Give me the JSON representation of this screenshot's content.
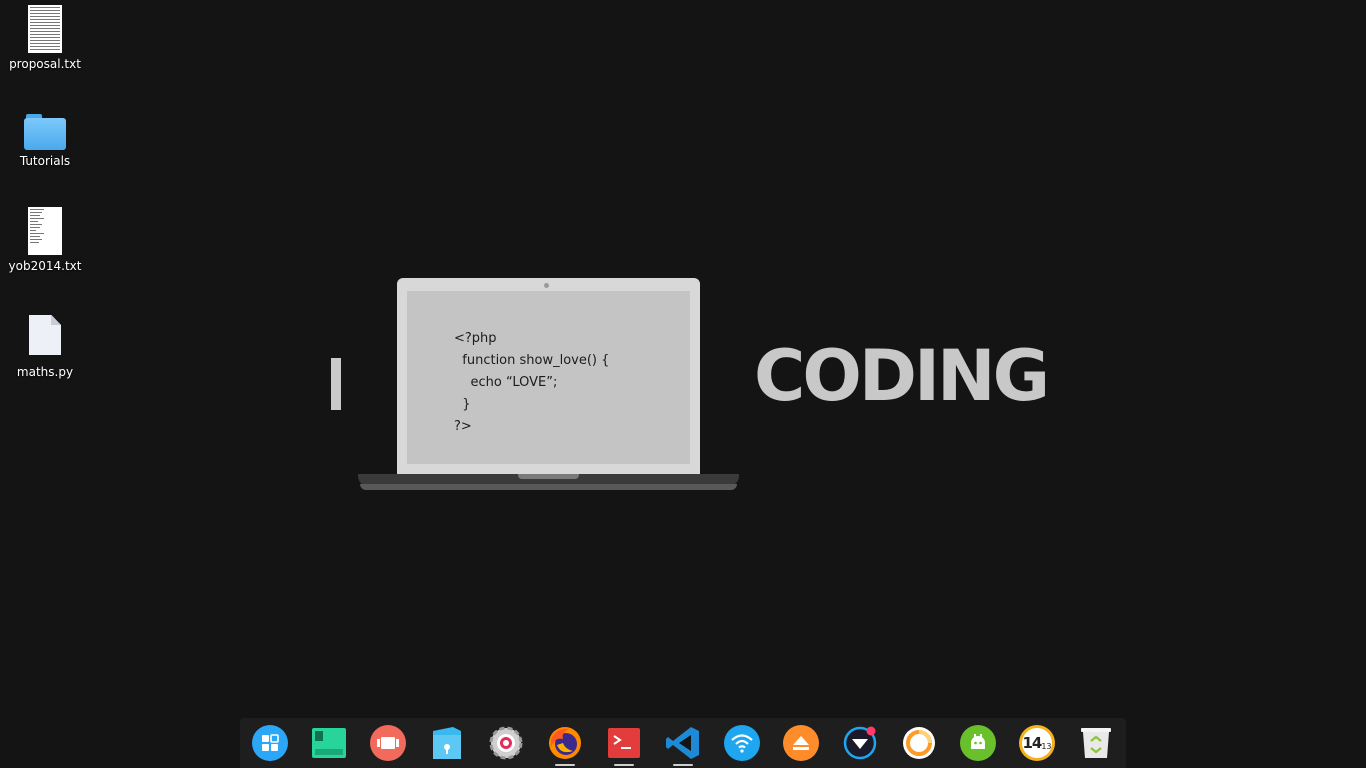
{
  "desktop": {
    "icons": [
      {
        "label": "proposal.txt",
        "icon": "text-document-icon"
      },
      {
        "label": "Tutorials",
        "icon": "folder-icon"
      },
      {
        "label": "yob2014.txt",
        "icon": "text-document-icon"
      },
      {
        "label": "maths.py",
        "icon": "blank-file-icon"
      }
    ]
  },
  "wallpaper": {
    "left_word": "I",
    "right_word": "CODING",
    "code_lines": [
      "<?php",
      "  function show_love() {",
      "    echo “LOVE”;",
      "  }",
      "?>"
    ]
  },
  "dock": {
    "items": [
      {
        "name": "launcher",
        "icon": "launcher-icon",
        "color": "#2ca7f8",
        "running": false
      },
      {
        "name": "multitasking",
        "icon": "multitask-view-icon",
        "color": "#27d49a",
        "running": false
      },
      {
        "name": "screen-recorder",
        "icon": "slides-icon",
        "color": "#f26a5c",
        "running": false
      },
      {
        "name": "file-manager",
        "icon": "file-manager-icon",
        "color": "#3ab8f0",
        "running": false
      },
      {
        "name": "control-center",
        "icon": "settings-gear-icon",
        "color": "#d0d0d0",
        "running": false
      },
      {
        "name": "firefox",
        "icon": "firefox-icon",
        "color": "#ff8a00",
        "running": true
      },
      {
        "name": "terminal",
        "icon": "terminal-icon",
        "color": "#e23c3c",
        "running": true
      },
      {
        "name": "vscode",
        "icon": "vscode-icon",
        "color": "#1e8ad6",
        "running": true
      },
      {
        "name": "network",
        "icon": "wifi-icon",
        "color": "#1ea6f0",
        "running": false
      },
      {
        "name": "eject",
        "icon": "eject-icon",
        "color": "#ff8c2a",
        "running": false
      },
      {
        "name": "store",
        "icon": "app-store-icon",
        "color": "#1a1a2a",
        "running": false
      },
      {
        "name": "backup",
        "icon": "ring-icon",
        "color": "#ff9a22",
        "running": false
      },
      {
        "name": "android",
        "icon": "android-icon",
        "color": "#6ac02a",
        "running": false
      },
      {
        "name": "clock",
        "icon": "clock-icon",
        "color": "#f6b21a",
        "running": false,
        "time_big": "14",
        "time_small": "13"
      },
      {
        "name": "trash",
        "icon": "trash-icon",
        "color": "#e9e9e9",
        "running": false
      }
    ]
  }
}
